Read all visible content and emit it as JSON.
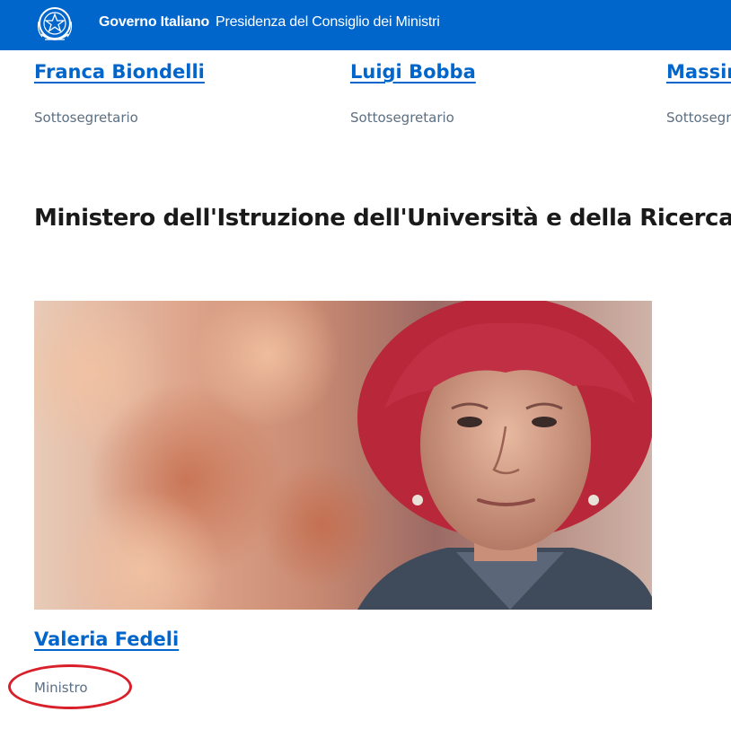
{
  "header": {
    "brand": "Governo Italiano",
    "subtitle": "Presidenza del Consiglio dei Ministri",
    "emblem_icon": "italian-republic-emblem-icon",
    "background_color": "#0066cc"
  },
  "top_people": [
    {
      "name": "Franca Biondelli",
      "role": "Sottosegretario"
    },
    {
      "name": "Luigi Bobba",
      "role": "Sottosegretario"
    },
    {
      "name": "Massin",
      "role": "Sottosegr"
    }
  ],
  "section": {
    "title": "Ministero dell'Istruzione dell'Università e della Ricerca"
  },
  "featured": {
    "name": "Valeria Fedeli",
    "role": "Ministro"
  },
  "colors": {
    "link": "#0066cc",
    "role_text": "#5c6f82",
    "annotation": "#d81f2a"
  }
}
